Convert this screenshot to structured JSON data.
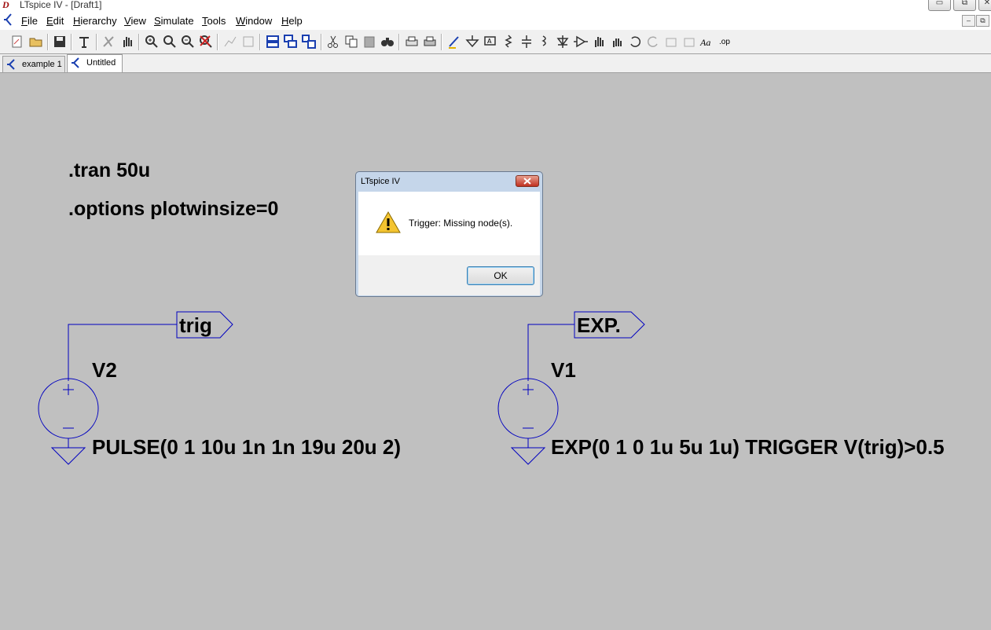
{
  "window": {
    "title": "LTspice IV - [Draft1]",
    "logo_text": "D",
    "buttons": {
      "minimize": "▭",
      "restore": "⧉",
      "close": "✕"
    }
  },
  "menu": {
    "items": [
      "File",
      "Edit",
      "Hierarchy",
      "View",
      "Simulate",
      "Tools",
      "Window",
      "Help"
    ],
    "mdi_buttons": {
      "minimize": "–",
      "restore": "⧉"
    }
  },
  "toolbar": {
    "buttons": [
      "new-schematic",
      "open",
      "save",
      "control-panel",
      "run",
      "halt",
      "zoom-in",
      "pan",
      "zoom-fit",
      "zoom-out",
      "zoom-cancel",
      "autorange",
      "fit",
      "tile-horizontal",
      "cascade",
      "tile-vertical",
      "cut",
      "copy",
      "paste",
      "find",
      "print-setup",
      "print",
      "draw-wire",
      "ground",
      "label-net",
      "resistor",
      "capacitor",
      "inductor",
      "diode",
      "component",
      "move",
      "drag",
      "undo",
      "redo",
      "rotate",
      "mirror",
      "text",
      "spice-directive"
    ],
    "text_icon": "Aa",
    "op_icon": ".op"
  },
  "tabs": [
    {
      "label": "example 1",
      "active": false
    },
    {
      "label": "Untitled",
      "active": true
    }
  ],
  "schematic": {
    "directives": [
      ".tran 50u",
      ".options plotwinsize=0"
    ],
    "sources": [
      {
        "name": "V2",
        "value": "PULSE(0 1 10u 1n 1n 19u 20u 2)",
        "net_label": "trig"
      },
      {
        "name": "V1",
        "value": "EXP(0 1 0 1u 5u 1u) TRIGGER V(trig)>0.5",
        "net_label": "EXP."
      }
    ],
    "wire_color": "#0000c0",
    "plus_sign": "+",
    "minus_sign": "–"
  },
  "dialog": {
    "title": "LTspice IV",
    "message": "Trigger: Missing node(s).",
    "ok_label": "OK",
    "icon": "warning-icon"
  }
}
